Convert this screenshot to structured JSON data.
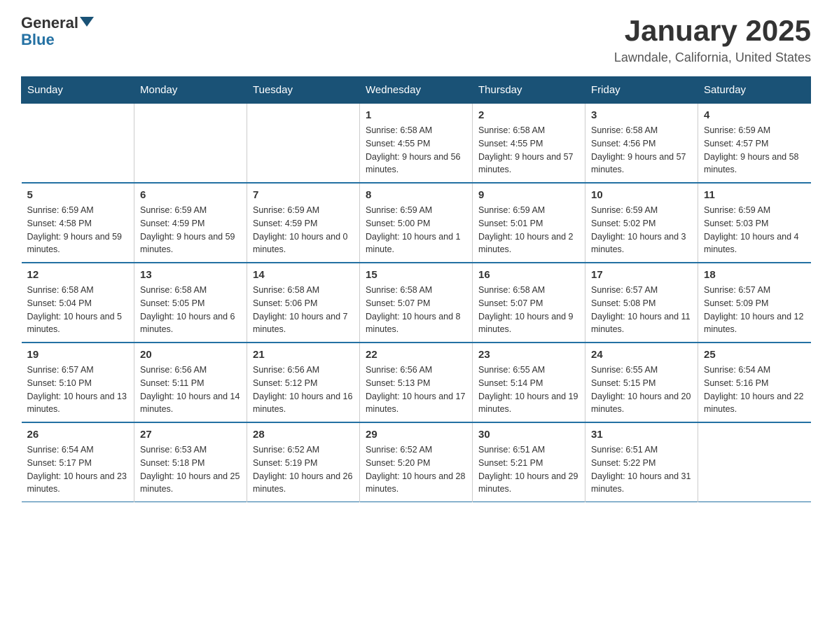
{
  "header": {
    "logo": {
      "general": "General",
      "blue": "Blue"
    },
    "title": "January 2025",
    "subtitle": "Lawndale, California, United States"
  },
  "calendar": {
    "days_of_week": [
      "Sunday",
      "Monday",
      "Tuesday",
      "Wednesday",
      "Thursday",
      "Friday",
      "Saturday"
    ],
    "weeks": [
      [
        {
          "day": "",
          "info": ""
        },
        {
          "day": "",
          "info": ""
        },
        {
          "day": "",
          "info": ""
        },
        {
          "day": "1",
          "info": "Sunrise: 6:58 AM\nSunset: 4:55 PM\nDaylight: 9 hours and 56 minutes."
        },
        {
          "day": "2",
          "info": "Sunrise: 6:58 AM\nSunset: 4:55 PM\nDaylight: 9 hours and 57 minutes."
        },
        {
          "day": "3",
          "info": "Sunrise: 6:58 AM\nSunset: 4:56 PM\nDaylight: 9 hours and 57 minutes."
        },
        {
          "day": "4",
          "info": "Sunrise: 6:59 AM\nSunset: 4:57 PM\nDaylight: 9 hours and 58 minutes."
        }
      ],
      [
        {
          "day": "5",
          "info": "Sunrise: 6:59 AM\nSunset: 4:58 PM\nDaylight: 9 hours and 59 minutes."
        },
        {
          "day": "6",
          "info": "Sunrise: 6:59 AM\nSunset: 4:59 PM\nDaylight: 9 hours and 59 minutes."
        },
        {
          "day": "7",
          "info": "Sunrise: 6:59 AM\nSunset: 4:59 PM\nDaylight: 10 hours and 0 minutes."
        },
        {
          "day": "8",
          "info": "Sunrise: 6:59 AM\nSunset: 5:00 PM\nDaylight: 10 hours and 1 minute."
        },
        {
          "day": "9",
          "info": "Sunrise: 6:59 AM\nSunset: 5:01 PM\nDaylight: 10 hours and 2 minutes."
        },
        {
          "day": "10",
          "info": "Sunrise: 6:59 AM\nSunset: 5:02 PM\nDaylight: 10 hours and 3 minutes."
        },
        {
          "day": "11",
          "info": "Sunrise: 6:59 AM\nSunset: 5:03 PM\nDaylight: 10 hours and 4 minutes."
        }
      ],
      [
        {
          "day": "12",
          "info": "Sunrise: 6:58 AM\nSunset: 5:04 PM\nDaylight: 10 hours and 5 minutes."
        },
        {
          "day": "13",
          "info": "Sunrise: 6:58 AM\nSunset: 5:05 PM\nDaylight: 10 hours and 6 minutes."
        },
        {
          "day": "14",
          "info": "Sunrise: 6:58 AM\nSunset: 5:06 PM\nDaylight: 10 hours and 7 minutes."
        },
        {
          "day": "15",
          "info": "Sunrise: 6:58 AM\nSunset: 5:07 PM\nDaylight: 10 hours and 8 minutes."
        },
        {
          "day": "16",
          "info": "Sunrise: 6:58 AM\nSunset: 5:07 PM\nDaylight: 10 hours and 9 minutes."
        },
        {
          "day": "17",
          "info": "Sunrise: 6:57 AM\nSunset: 5:08 PM\nDaylight: 10 hours and 11 minutes."
        },
        {
          "day": "18",
          "info": "Sunrise: 6:57 AM\nSunset: 5:09 PM\nDaylight: 10 hours and 12 minutes."
        }
      ],
      [
        {
          "day": "19",
          "info": "Sunrise: 6:57 AM\nSunset: 5:10 PM\nDaylight: 10 hours and 13 minutes."
        },
        {
          "day": "20",
          "info": "Sunrise: 6:56 AM\nSunset: 5:11 PM\nDaylight: 10 hours and 14 minutes."
        },
        {
          "day": "21",
          "info": "Sunrise: 6:56 AM\nSunset: 5:12 PM\nDaylight: 10 hours and 16 minutes."
        },
        {
          "day": "22",
          "info": "Sunrise: 6:56 AM\nSunset: 5:13 PM\nDaylight: 10 hours and 17 minutes."
        },
        {
          "day": "23",
          "info": "Sunrise: 6:55 AM\nSunset: 5:14 PM\nDaylight: 10 hours and 19 minutes."
        },
        {
          "day": "24",
          "info": "Sunrise: 6:55 AM\nSunset: 5:15 PM\nDaylight: 10 hours and 20 minutes."
        },
        {
          "day": "25",
          "info": "Sunrise: 6:54 AM\nSunset: 5:16 PM\nDaylight: 10 hours and 22 minutes."
        }
      ],
      [
        {
          "day": "26",
          "info": "Sunrise: 6:54 AM\nSunset: 5:17 PM\nDaylight: 10 hours and 23 minutes."
        },
        {
          "day": "27",
          "info": "Sunrise: 6:53 AM\nSunset: 5:18 PM\nDaylight: 10 hours and 25 minutes."
        },
        {
          "day": "28",
          "info": "Sunrise: 6:52 AM\nSunset: 5:19 PM\nDaylight: 10 hours and 26 minutes."
        },
        {
          "day": "29",
          "info": "Sunrise: 6:52 AM\nSunset: 5:20 PM\nDaylight: 10 hours and 28 minutes."
        },
        {
          "day": "30",
          "info": "Sunrise: 6:51 AM\nSunset: 5:21 PM\nDaylight: 10 hours and 29 minutes."
        },
        {
          "day": "31",
          "info": "Sunrise: 6:51 AM\nSunset: 5:22 PM\nDaylight: 10 hours and 31 minutes."
        },
        {
          "day": "",
          "info": ""
        }
      ]
    ]
  }
}
